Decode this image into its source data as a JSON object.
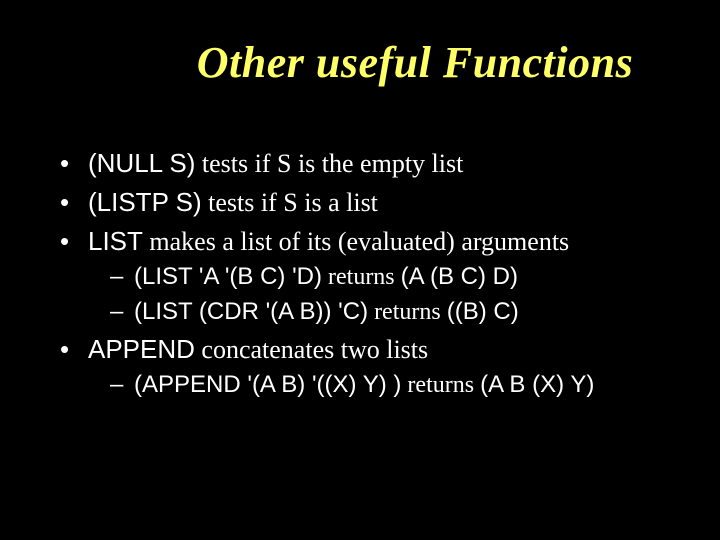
{
  "slide": {
    "title": "Other useful Functions",
    "bullets": [
      {
        "code": "(NULL S)",
        "prose": " tests if S is the empty list",
        "sub": []
      },
      {
        "code": "(LISTP S)",
        "prose": " tests if S is a list",
        "sub": []
      },
      {
        "code": "LIST",
        "prose": " makes a list of its (evaluated) arguments",
        "sub": [
          {
            "code": "(LIST 'A '(B C) 'D)",
            "prose_pre": " returns ",
            "code2": "(A (B C) D)"
          },
          {
            "code": "(LIST (CDR '(A B)) 'C)",
            "prose_pre": " returns ",
            "code2": "((B) C)"
          }
        ]
      },
      {
        "code": "APPEND",
        "prose": " concatenates two lists",
        "sub": [
          {
            "code": "(APPEND '(A B) '((X) Y) )",
            "prose_pre": " returns ",
            "code2": "(A B (X) Y)"
          }
        ]
      }
    ]
  }
}
